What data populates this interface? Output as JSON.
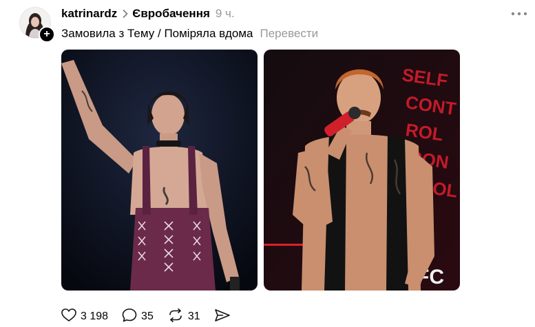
{
  "post": {
    "username": "katrinardz",
    "community": "Євробачення",
    "time": "9 ч.",
    "caption": "Замовила з Тему / Поміряла вдома",
    "translate_label": "Перевести",
    "photo_text_right": "SELF CONTROL"
  },
  "actions": {
    "likes": "3 198",
    "comments": "35",
    "reposts": "31"
  },
  "colors": {
    "accent_red": "#d81b2a",
    "muted_text": "#999999"
  },
  "icons": [
    "heart-icon",
    "comment-icon",
    "repost-icon",
    "share-icon",
    "more-icon",
    "chevron-right-icon",
    "plus-icon"
  ]
}
